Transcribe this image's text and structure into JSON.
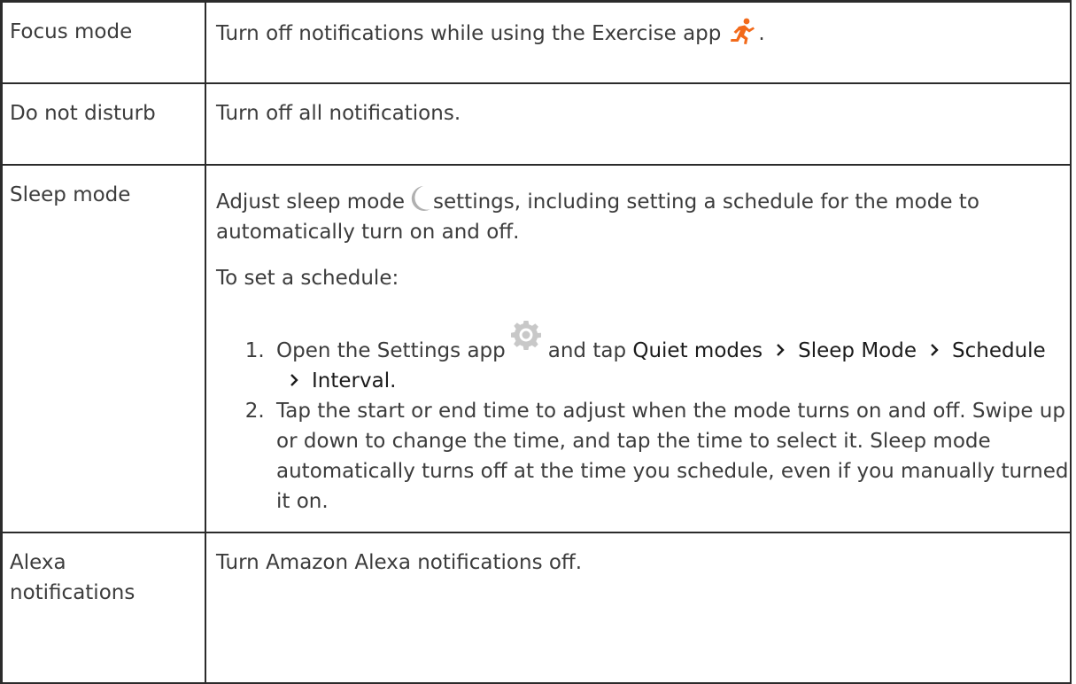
{
  "rows": [
    {
      "name": "Focus mode",
      "description_before_icon": "Turn off notifications while using the Exercise app",
      "description_after_icon": ".",
      "icon": "exercise-run-icon",
      "icon_color": "#f26a1b"
    },
    {
      "name": "Do not disturb",
      "description": "Turn off all notifications."
    },
    {
      "name": "Sleep mode",
      "intro_before_icon": "Adjust sleep mode",
      "intro_after_icon": "settings, including setting a schedule for the mode to automatically turn on and off.",
      "icon": "moon-icon",
      "icon_color": "#b0b0b0",
      "schedule_heading": "To set a schedule:",
      "steps": {
        "step1_prefix": "Open the Settings app",
        "step1_mid": "and tap",
        "path_1": "Quiet modes",
        "path_2": "Sleep Mode",
        "path_3": "Schedule",
        "path_4": "Interval.",
        "step2": "Tap the start or end time to adjust when the mode turns on and off. Swipe up or down to change the time, and tap the time to select it. Sleep mode automatically turns off at the time you schedule, even if you manually turned it on."
      },
      "settings_icon": "gear-icon",
      "settings_icon_color": "#c8c8c8",
      "chevron_icon": "chevron-right-icon"
    },
    {
      "name": "Alexa notifications",
      "description": "Turn Amazon Alexa notifications off."
    }
  ]
}
